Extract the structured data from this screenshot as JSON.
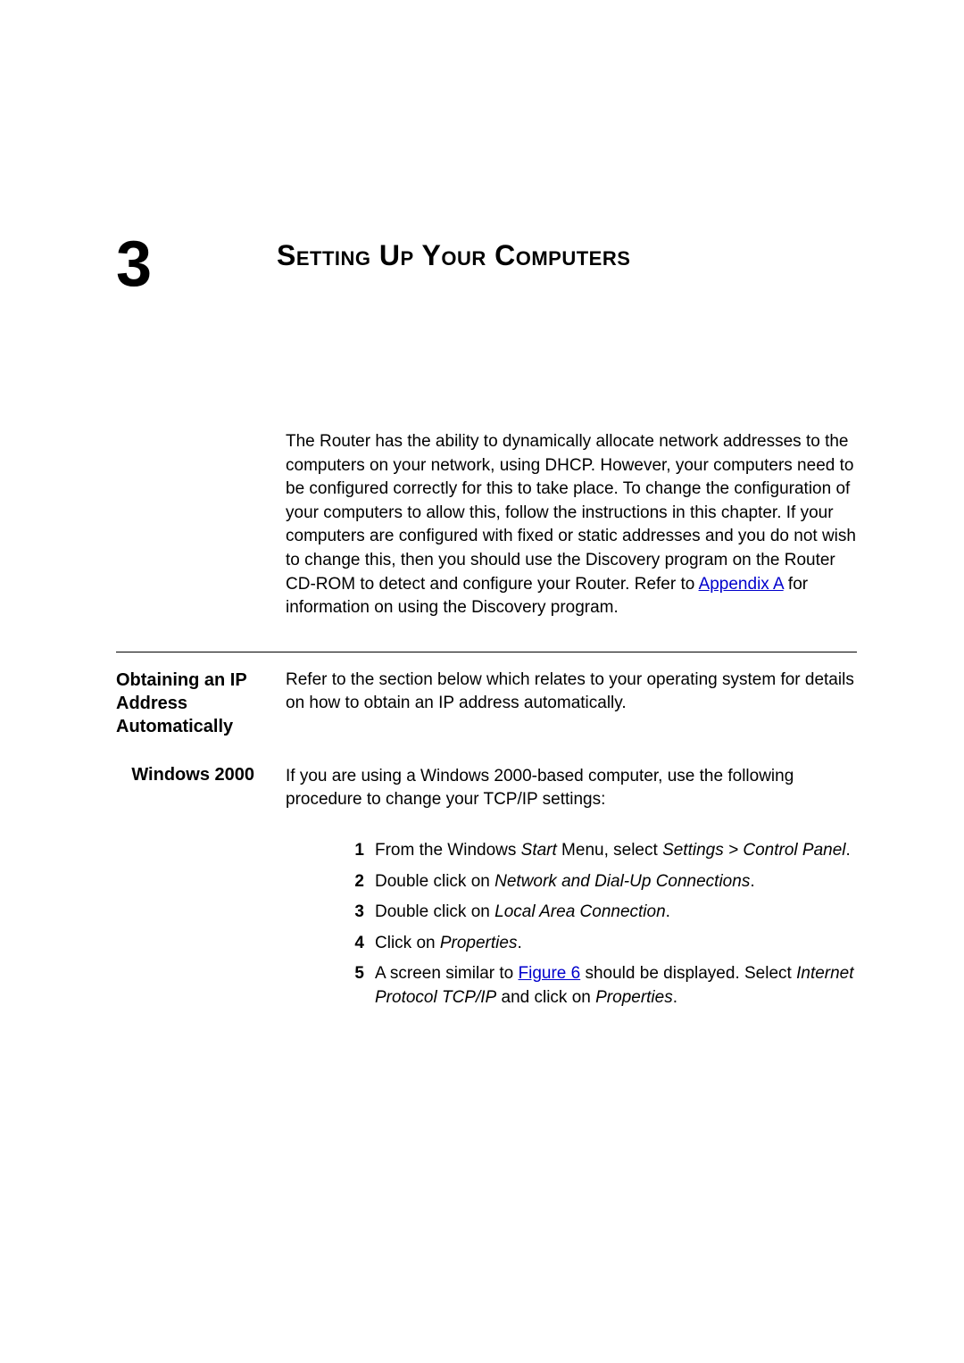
{
  "chapter": {
    "number": "3",
    "title": "Setting Up Your Computers"
  },
  "intro": {
    "text_before_link": "The Router has the ability to dynamically allocate network addresses to the computers on your network, using DHCP. However, your computers need to be configured correctly for this to take place. To change the configuration of your computers to allow this, follow the instructions in this chapter. If your computers are configured with fixed or static addresses and you do not wish to change this, then you should use the Discovery program on the Router CD-ROM to detect and configure your Router. Refer to ",
    "link_text": "Appendix A",
    "text_after_link": " for information on using the Discovery program."
  },
  "section1": {
    "heading": "Obtaining an IP Address Automatically",
    "body": "Refer to the section below which relates to your operating system for details on how to obtain an IP address automatically."
  },
  "section2": {
    "sub_heading": "Windows 2000",
    "body": "If you are using a Windows 2000-based computer, use the following procedure to change your TCP/IP settings:"
  },
  "steps": [
    {
      "num": "1",
      "parts": [
        {
          "t": "From the Windows "
        },
        {
          "t": "Start",
          "italic": true
        },
        {
          "t": " Menu, select "
        },
        {
          "t": "Settings > Control Panel",
          "italic": true
        },
        {
          "t": "."
        }
      ]
    },
    {
      "num": "2",
      "parts": [
        {
          "t": "Double click on "
        },
        {
          "t": "Network and Dial-Up Connections",
          "italic": true
        },
        {
          "t": "."
        }
      ]
    },
    {
      "num": "3",
      "parts": [
        {
          "t": "Double click on "
        },
        {
          "t": "Local Area Connection",
          "italic": true
        },
        {
          "t": "."
        }
      ]
    },
    {
      "num": "4",
      "parts": [
        {
          "t": "Click on "
        },
        {
          "t": "Properties",
          "italic": true
        },
        {
          "t": "."
        }
      ]
    },
    {
      "num": "5",
      "parts": [
        {
          "t": "A screen similar to "
        },
        {
          "t": "Figure 6",
          "link": true
        },
        {
          "t": " should be displayed. Select "
        },
        {
          "t": "Internet Protocol TCP/IP",
          "italic": true
        },
        {
          "t": " and click on "
        },
        {
          "t": "Properties",
          "italic": true
        },
        {
          "t": "."
        }
      ]
    }
  ]
}
